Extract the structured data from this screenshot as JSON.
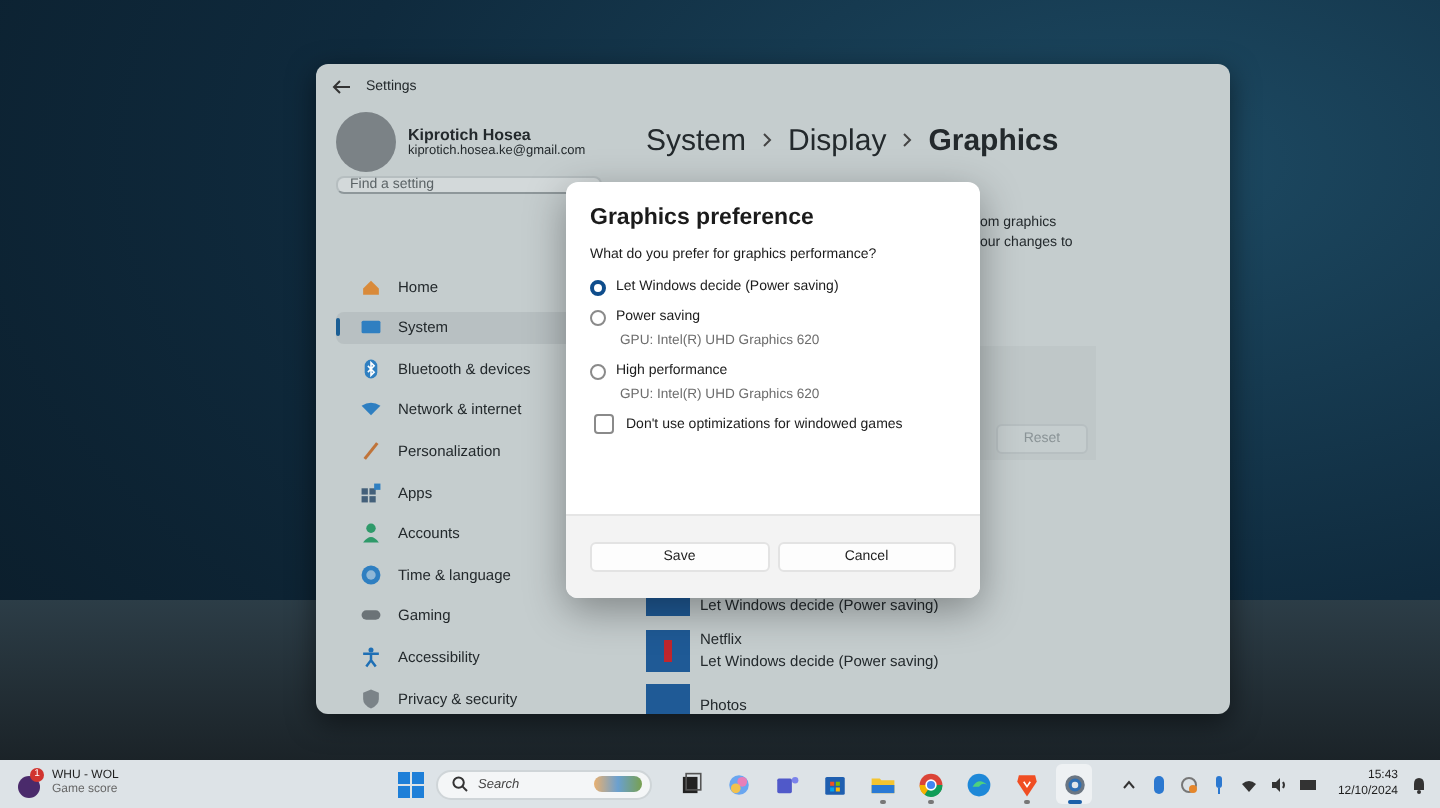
{
  "settings_window": {
    "title": "Settings",
    "profile": {
      "name": "Kiprotich Hosea",
      "email": "kiprotich.hosea.ke@gmail.com"
    },
    "search": {
      "placeholder": "Find a setting"
    },
    "nav": [
      {
        "label": "Home",
        "selected": false
      },
      {
        "label": "System",
        "selected": true
      },
      {
        "label": "Bluetooth & devices",
        "selected": false
      },
      {
        "label": "Network & internet",
        "selected": false
      },
      {
        "label": "Personalization",
        "selected": false
      },
      {
        "label": "Apps",
        "selected": false
      },
      {
        "label": "Accounts",
        "selected": false
      },
      {
        "label": "Time & language",
        "selected": false
      },
      {
        "label": "Gaming",
        "selected": false
      },
      {
        "label": "Accessibility",
        "selected": false
      },
      {
        "label": "Privacy & security",
        "selected": false
      }
    ],
    "breadcrumb": [
      "System",
      "Display",
      "Graphics"
    ],
    "description_fragments": [
      "om graphics",
      "our changes to"
    ],
    "reset_button": "Reset",
    "apps": [
      {
        "status": "Let Windows decide (Power saving)"
      },
      {
        "name": "Netflix",
        "status": "Let Windows decide (Power saving)"
      },
      {
        "name": "Photos"
      }
    ]
  },
  "dialog": {
    "title": "Graphics preference",
    "question": "What do you prefer for graphics performance?",
    "options": [
      {
        "label": "Let Windows decide (Power saving)",
        "selected": true
      },
      {
        "label": "Power saving",
        "detail": "GPU: Intel(R) UHD Graphics 620",
        "selected": false
      },
      {
        "label": "High performance",
        "detail": "GPU: Intel(R) UHD Graphics 620",
        "selected": false
      }
    ],
    "checkbox": {
      "label": "Don't use optimizations for windowed games",
      "checked": false
    },
    "buttons": [
      "Save",
      "Cancel"
    ]
  },
  "taskbar": {
    "widget": {
      "title": "WHU - WOL",
      "subtitle": "Game score",
      "badge": "1"
    },
    "search": {
      "placeholder": "Search"
    },
    "apps": [
      {
        "running": false,
        "selected": false
      },
      {
        "running": false,
        "selected": false
      },
      {
        "running": false,
        "selected": false
      },
      {
        "running": false,
        "selected": false
      },
      {
        "running": true,
        "selected": false
      },
      {
        "running": true,
        "selected": false
      },
      {
        "running": false,
        "selected": false
      },
      {
        "running": true,
        "selected": false
      },
      {
        "running": true,
        "selected": true
      }
    ],
    "time": "15:43",
    "date": "12/10/2024"
  }
}
